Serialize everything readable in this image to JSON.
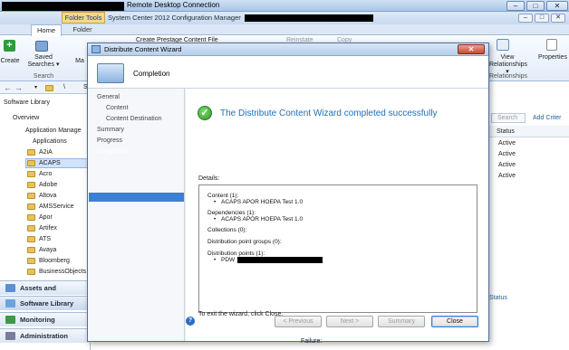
{
  "rdc": {
    "title": "Remote Desktop Connection",
    "min": "–",
    "max": "□",
    "close": "✕"
  },
  "sccm": {
    "folder_tools": "Folder Tools",
    "title": "System Center 2012 Configuration Manager",
    "ctrl_min": "–",
    "ctrl_max": "□",
    "ctrl_close": "✕"
  },
  "ribbon": {
    "tabs": [
      "Home",
      "Folder"
    ],
    "create": "Create",
    "saved_searches": "Saved Searches ▾",
    "search_group": "Search",
    "manage_partial": "Ma",
    "create_prestage": "Create Prestage Content File",
    "reinstate": "Reinstate",
    "copy": "Copy",
    "view_relationships": "View Relationships ▾",
    "relationships_group": "Relationships",
    "properties": "Properties"
  },
  "nav": {
    "path": "\\",
    "path_partial": "S"
  },
  "left_pane": {
    "header": "Software Library",
    "overview": "Overview",
    "application_management": "Application Manage",
    "applications": "Applications",
    "folders": [
      "A2iA",
      "ACAPS",
      "Acro",
      "Adobe",
      "Altova",
      "AMSService",
      "Apor",
      "Artifex",
      "ATS",
      "Avaya",
      "Bloomberg",
      "BusinessObjects"
    ],
    "workspaces": [
      "Assets and Compliance",
      "Software Library",
      "Monitoring",
      "Administration"
    ]
  },
  "right_pane": {
    "search": "Search",
    "add_criteria": "Add Criter",
    "status_header": "Status",
    "statuses": [
      "Active",
      "Active",
      "Active",
      "Active"
    ],
    "status_label": "Status"
  },
  "dialog": {
    "title": "Distribute Content Wizard",
    "header": "Completion",
    "steps": [
      "General",
      "Content",
      "Content Destination",
      "Summary",
      "Progress",
      "Completion"
    ],
    "success": "The Distribute Content Wizard completed successfully",
    "details_label": "Details:",
    "details": {
      "content_h": "Content (1):",
      "content_item": "ACAPS APOR HOEPA Test 1.0",
      "dep_h": "Dependencies (1):",
      "dep_item": "ACAPS APOR HOEPA Test 1.0",
      "collections": "Collections (0):",
      "dp_groups": "Distribution point groups (0):",
      "dp_h": "Distribution points (1):",
      "dp_item": "PDW"
    },
    "exit_text": "To exit the wizard, click Close.",
    "buttons": {
      "previous": "< Previous",
      "next": "Next >",
      "summary": "Summary",
      "close": "Close"
    }
  },
  "bottom": {
    "failure": "Failure:"
  }
}
